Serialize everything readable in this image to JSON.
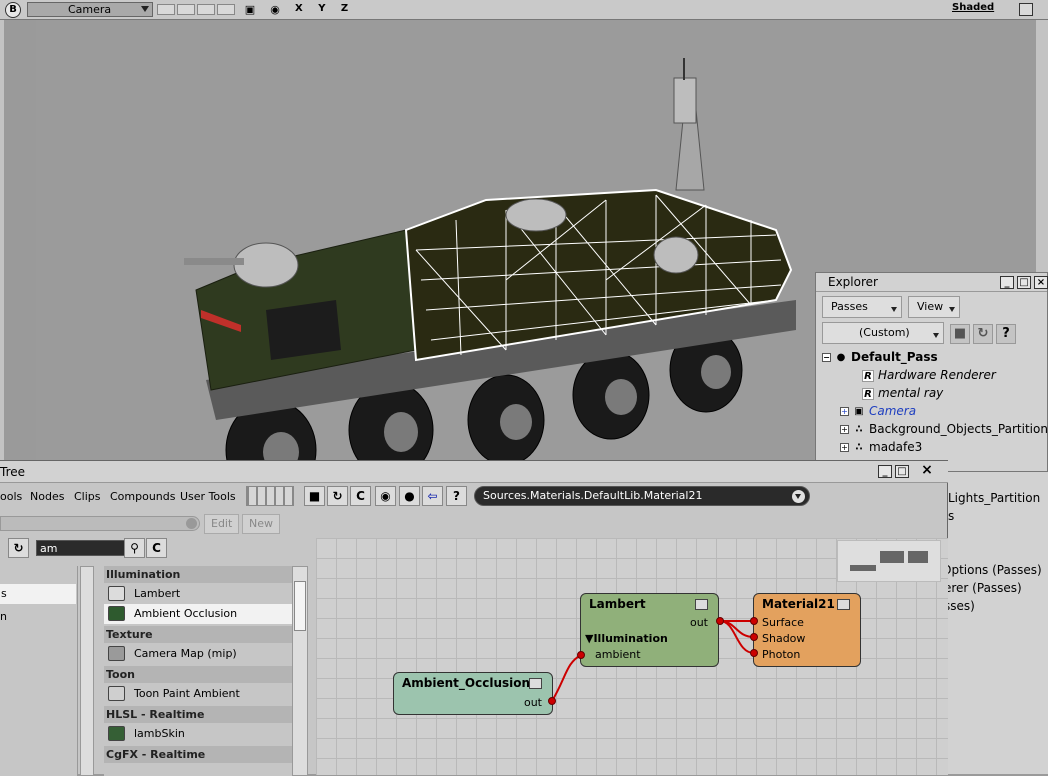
{
  "viewport": {
    "badge": "B",
    "camera_label": "Camera",
    "axes": "X Y Z",
    "shading": "Shaded"
  },
  "explorer": {
    "title": "Explorer",
    "passes_btn": "Passes",
    "view_btn": "View",
    "scope": "(Custom)",
    "tree": [
      {
        "label": "Default_Pass",
        "style": "bold"
      },
      {
        "label": "Hardware Renderer",
        "style": "italic"
      },
      {
        "label": "mental ray",
        "style": "italic"
      },
      {
        "label": "Camera",
        "style": "italic-blue"
      },
      {
        "label": "Background_Objects_Partition",
        "style": "normal"
      },
      {
        "label": "madafe3",
        "style": "normal"
      }
    ],
    "tail": [
      "Lights_Partition",
      "s",
      "Options (Passes)",
      "erer (Passes)",
      "sses)"
    ]
  },
  "render_tree": {
    "title": "Tree",
    "menu": [
      "ools",
      "Nodes",
      "Clips",
      "Compounds",
      "User Tools"
    ],
    "path": "Sources.Materials.DefaultLib.Material21",
    "edit_btn": "Edit",
    "new_btn": "New",
    "search_value": "am",
    "left_list": [
      "s",
      "n"
    ],
    "node_list": [
      {
        "type": "head",
        "label": "Illumination"
      },
      {
        "type": "item",
        "label": "Lambert",
        "color": "#dcdcdc"
      },
      {
        "type": "item",
        "label": "Ambient Occlusion",
        "color": "#2e5a2e",
        "selected": true
      },
      {
        "type": "head",
        "label": "Texture"
      },
      {
        "type": "item",
        "label": "Camera Map (mip)",
        "color": "#9a9a9a"
      },
      {
        "type": "head",
        "label": "Toon"
      },
      {
        "type": "item",
        "label": "Toon Paint Ambient",
        "color": "#cfcfcf"
      },
      {
        "type": "head",
        "label": "HLSL - Realtime"
      },
      {
        "type": "item",
        "label": "lambSkin",
        "color": "#355f35"
      },
      {
        "type": "head",
        "label": "CgFX - Realtime"
      }
    ],
    "nodes": {
      "lambert": {
        "title": "Lambert",
        "out": "out",
        "group": "▼Illumination",
        "input": "ambient",
        "color": "#90b07a"
      },
      "material": {
        "title": "Material21",
        "ports": [
          "Surface",
          "Shadow",
          "Photon"
        ],
        "color": "#e3a15e"
      },
      "ao": {
        "title": "Ambient_Occlusion",
        "out": "out",
        "color": "#9cc4ae"
      }
    }
  }
}
